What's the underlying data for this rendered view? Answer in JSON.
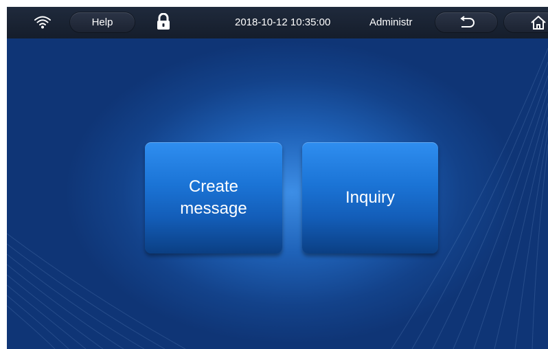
{
  "statusbar": {
    "wifi_icon": "wifi-icon",
    "help_label": "Help",
    "lock_icon": "lock-icon",
    "datetime": "2018-10-12 10:35:00",
    "user": "Administr",
    "back_icon": "back-arrow-icon",
    "home_icon": "home-icon"
  },
  "main": {
    "create_line1": "Create",
    "create_line2": "message",
    "inquiry_label": "Inquiry"
  },
  "colors": {
    "statusbar": "#1a2332",
    "background": "#13428a",
    "button": "#1b74d6"
  }
}
